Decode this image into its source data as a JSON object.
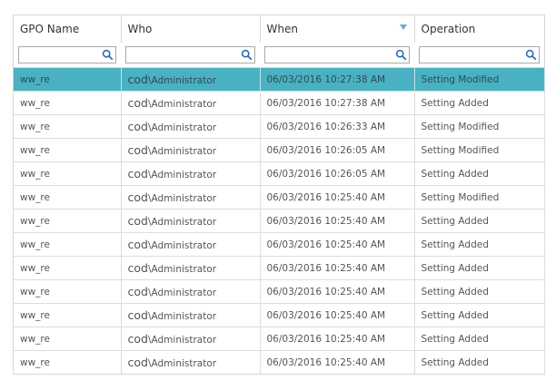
{
  "columns": [
    {
      "label": "GPO Name"
    },
    {
      "label": "Who"
    },
    {
      "label": "When",
      "sort_icon": "sort-descending-icon"
    },
    {
      "label": "Operation"
    }
  ],
  "filter": {
    "icon": "search-icon",
    "values": [
      "",
      "",
      "",
      ""
    ]
  },
  "colors": {
    "selected_row": "#4ab1c3",
    "sort_icon": "#6aa8d8",
    "search_icon": "#2b6cb0"
  },
  "rows": [
    {
      "gpo": "ww_re",
      "who_prefix": "cod",
      "who_rest": "\\Administrator",
      "when": "06/03/2016 10:27:38 AM",
      "operation": "Setting Modified",
      "selected": true
    },
    {
      "gpo": "ww_re",
      "who_prefix": "cod",
      "who_rest": "\\Administrator",
      "when": "06/03/2016 10:27:38 AM",
      "operation": "Setting Added"
    },
    {
      "gpo": "ww_re",
      "who_prefix": "cod",
      "who_rest": "\\Administrator",
      "when": "06/03/2016 10:26:33 AM",
      "operation": "Setting Modified"
    },
    {
      "gpo": "ww_re",
      "who_prefix": "cod",
      "who_rest": "\\Administrator",
      "when": "06/03/2016 10:26:05 AM",
      "operation": "Setting Modified"
    },
    {
      "gpo": "ww_re",
      "who_prefix": "cod",
      "who_rest": "\\Administrator",
      "when": "06/03/2016 10:26:05 AM",
      "operation": "Setting Added"
    },
    {
      "gpo": "ww_re",
      "who_prefix": "cod",
      "who_rest": "\\Administrator",
      "when": "06/03/2016 10:25:40 AM",
      "operation": "Setting Modified"
    },
    {
      "gpo": "ww_re",
      "who_prefix": "cod",
      "who_rest": "\\Administrator",
      "when": "06/03/2016 10:25:40 AM",
      "operation": "Setting Added"
    },
    {
      "gpo": "ww_re",
      "who_prefix": "cod",
      "who_rest": "\\Administrator",
      "when": "06/03/2016 10:25:40 AM",
      "operation": "Setting Added"
    },
    {
      "gpo": "ww_re",
      "who_prefix": "cod",
      "who_rest": "\\Administrator",
      "when": "06/03/2016 10:25:40 AM",
      "operation": "Setting Added"
    },
    {
      "gpo": "ww_re",
      "who_prefix": "cod",
      "who_rest": "\\Administrator",
      "when": "06/03/2016 10:25:40 AM",
      "operation": "Setting Added"
    },
    {
      "gpo": "ww_re",
      "who_prefix": "cod",
      "who_rest": "\\Administrator",
      "when": "06/03/2016 10:25:40 AM",
      "operation": "Setting Added"
    },
    {
      "gpo": "ww_re",
      "who_prefix": "cod",
      "who_rest": "\\Administrator",
      "when": "06/03/2016 10:25:40 AM",
      "operation": "Setting Added"
    },
    {
      "gpo": "ww_re",
      "who_prefix": "cod",
      "who_rest": "\\Administrator",
      "when": "06/03/2016 10:25:40 AM",
      "operation": "Setting Added"
    }
  ]
}
